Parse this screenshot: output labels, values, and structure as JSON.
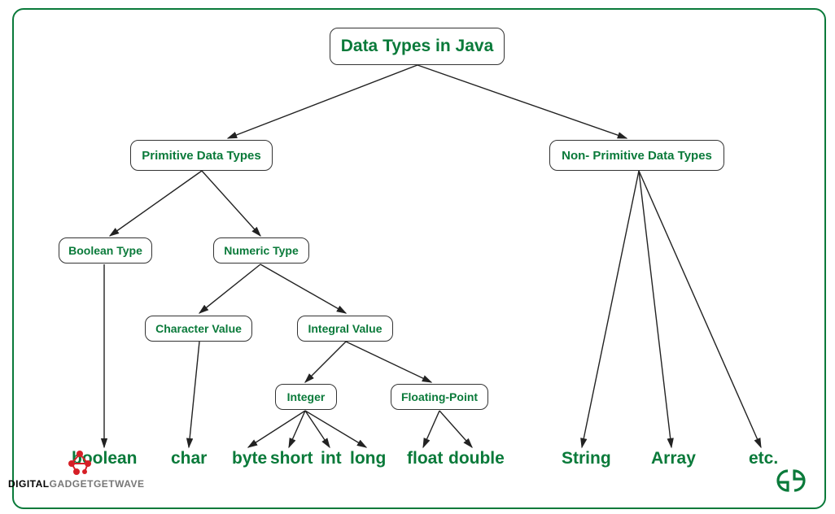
{
  "title": "Data Types in Java",
  "nodes": {
    "primitive": "Primitive Data Types",
    "nonprimitive": "Non- Primitive Data Types",
    "boolean_type": "Boolean Type",
    "numeric_type": "Numeric Type",
    "character_value": "Character Value",
    "integral_value": "Integral Value",
    "integer": "Integer",
    "floating": "Floating-Point"
  },
  "leaves": {
    "boolean": "boolean",
    "char": "char",
    "byte": "byte",
    "short": "short",
    "int": "int",
    "long": "long",
    "float": "float",
    "double": "double",
    "string": "String",
    "array": "Array",
    "etc": "etc."
  },
  "watermark": {
    "brand1": "DIGITAL",
    "brand2": "GADGETGETWAVE"
  },
  "logo": "ƎG"
}
